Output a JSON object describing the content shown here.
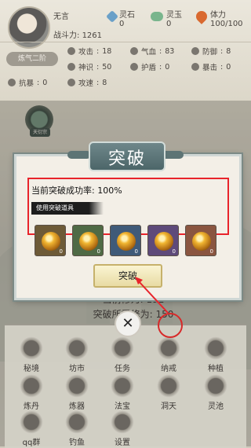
{
  "player": {
    "name": "无言",
    "power_label": "战斗力:",
    "power_value": "1261",
    "rank": "炼气二阶"
  },
  "resources": [
    {
      "label": "灵石",
      "value": "0",
      "icon": "spirit-stone-icon",
      "color": "#6aa0c8"
    },
    {
      "label": "灵玉",
      "value": "0",
      "icon": "spirit-jade-icon",
      "color": "#79b58d"
    },
    {
      "label": "体力",
      "value": "100/100",
      "icon": "stamina-icon",
      "color": "#d9692f"
    }
  ],
  "stats": [
    {
      "label": "攻击",
      "value": "18"
    },
    {
      "label": "气血",
      "value": "83"
    },
    {
      "label": "防御",
      "value": "8"
    },
    {
      "label": "神识",
      "value": "50"
    },
    {
      "label": "护盾",
      "value": "0"
    },
    {
      "label": "暴击",
      "value": "0"
    },
    {
      "label": "抗暴",
      "value": "0"
    },
    {
      "label": "攻速",
      "value": "8"
    }
  ],
  "realm_badge_label": "天衍宗",
  "dialog": {
    "title": "突破",
    "success_rate_label": "当前突破成功率:",
    "success_rate_value": "100%",
    "use_item_label": "使用突破道具",
    "items": [
      {
        "count": "0",
        "bg": "#6d5a37"
      },
      {
        "count": "0",
        "bg": "#4f6a45"
      },
      {
        "count": "0",
        "bg": "#3f5a78"
      },
      {
        "count": "0",
        "bg": "#5e4a7a"
      },
      {
        "count": "0",
        "bg": "#8a5540"
      }
    ],
    "confirm_label": "突破"
  },
  "cultivation": {
    "current_label": "当前修为:",
    "current_value": "191",
    "required_label": "突破所需修为:",
    "required_value": "150"
  },
  "functions": [
    "秘境",
    "坊市",
    "任务",
    "纳戒",
    "种植",
    "炼丹",
    "炼器",
    "法宝",
    "洞天",
    "灵池",
    "qq群",
    "钓鱼",
    "设置"
  ],
  "close_icon": "close-icon"
}
